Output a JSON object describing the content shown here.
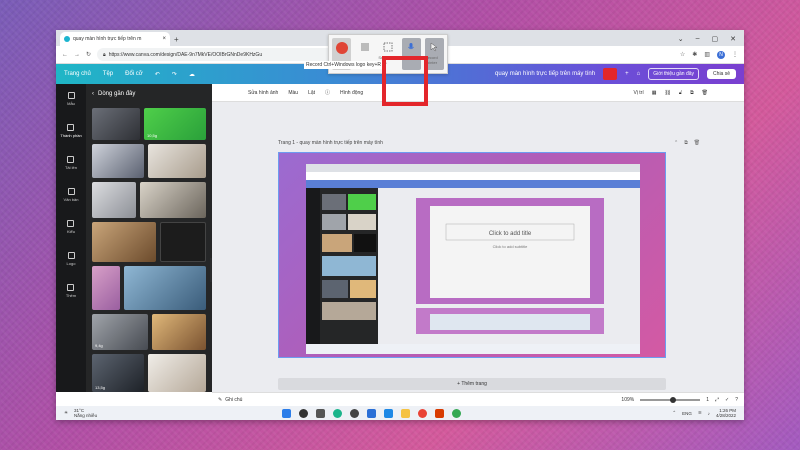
{
  "browser": {
    "tab_title": "quay màn hình trực tiếp trên m",
    "url": "https://www.canva.com/design/DAE-9n7MkVE/OOIBrGNnDe9KHzGu"
  },
  "recorder": {
    "tooltip": "Record Ctrl+Windows logo key+R",
    "btn_labels": [
      "",
      "",
      "Select area",
      "Audio",
      "Record pointer"
    ]
  },
  "canva": {
    "home": "Trang chủ",
    "file": "Tệp",
    "resize": "Đổi cỡ",
    "title": "quay màn hình trực tiếp trên máy tính",
    "trial": "Dùng thử Canva Pro",
    "present": "Giới thiệu gần đây",
    "share": "Chia sẻ",
    "avatar": "N"
  },
  "rail": {
    "items": [
      "Mẫu",
      "Thành phần",
      "Tải lên",
      "Văn bản",
      "Kiểu",
      "Logo",
      "Thêm"
    ]
  },
  "panel": {
    "title": "Dòng gần đây",
    "badges": [
      "10,5g",
      "9,4g",
      "13,5g"
    ]
  },
  "edit_toolbar": {
    "items": [
      "Sửa hình ảnh",
      "Màu",
      "Lật",
      "ⓘ",
      "Hình động"
    ],
    "position": "Vị trí"
  },
  "page": {
    "label": "Trang 1 - quay màn hình trực tiếp trên máy tính",
    "slide_text": "Click to add title",
    "slide_sub": "Click to add subtitle",
    "add_page": "+ Thêm trang"
  },
  "status": {
    "notes": "Ghi chú",
    "zoom": "109%",
    "zoom_fraction": 0.55,
    "pages": "1"
  },
  "taskbar": {
    "temp": "31°C",
    "weather": "Nắng nhiều",
    "lang": "ENG",
    "time": "1:26 PM",
    "date": "4/28/2022"
  }
}
